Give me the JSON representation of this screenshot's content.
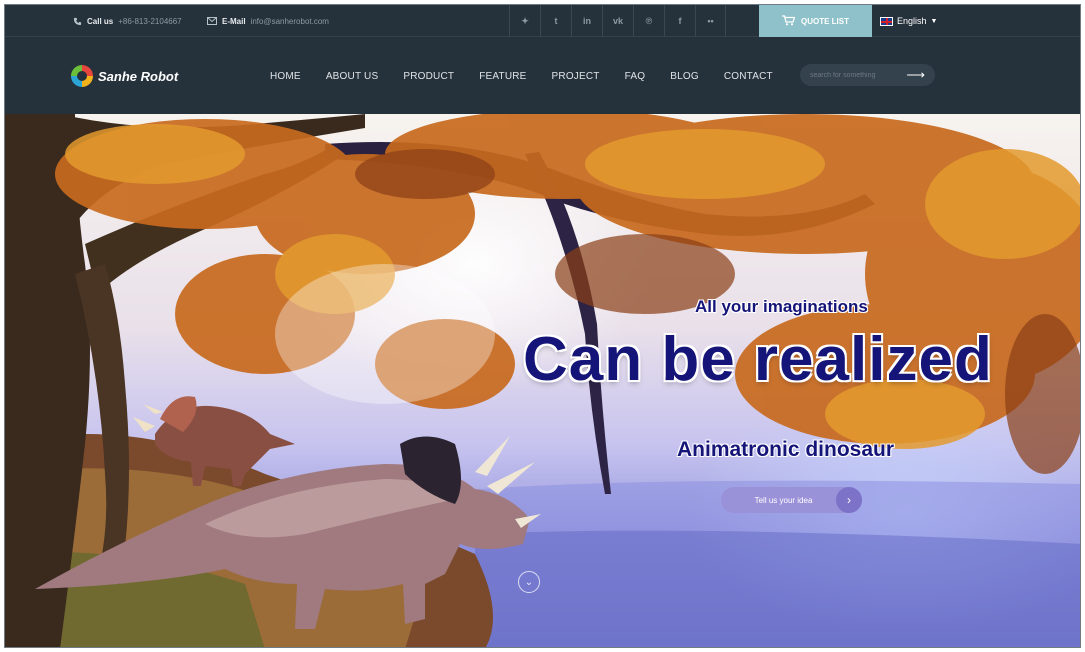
{
  "topbar": {
    "call_label": "Call us",
    "call_value": "+86-813-2104667",
    "email_label": "E-Mail",
    "email_value": "info@sanherobot.com",
    "social": [
      "twitter-icon",
      "tumblr-icon",
      "linkedin-icon",
      "vk-icon",
      "pinterest-icon",
      "facebook-icon",
      "flickr-icon"
    ],
    "social_glyphs": [
      "✦",
      "t",
      "in",
      "vk",
      "℗",
      "f",
      "••"
    ],
    "quote_label": "QUOTE LIST",
    "language": "English"
  },
  "nav": {
    "brand": "Sanhe Robot",
    "items": [
      "HOME",
      "ABOUT US",
      "PRODUCT",
      "FEATURE",
      "PROJECT",
      "FAQ",
      "BLOG",
      "CONTACT"
    ],
    "search_placeholder": "search for something"
  },
  "hero": {
    "tagline": "All your imaginations",
    "headline": "Can be realized",
    "subheading": "Animatronic dinosaur",
    "cta_label": "Tell us your idea"
  },
  "colors": {
    "header_bg": "#26323b",
    "quote_bg": "#8ec1c9",
    "headline_color": "#151478",
    "cta_bg": "#9a92d8"
  }
}
